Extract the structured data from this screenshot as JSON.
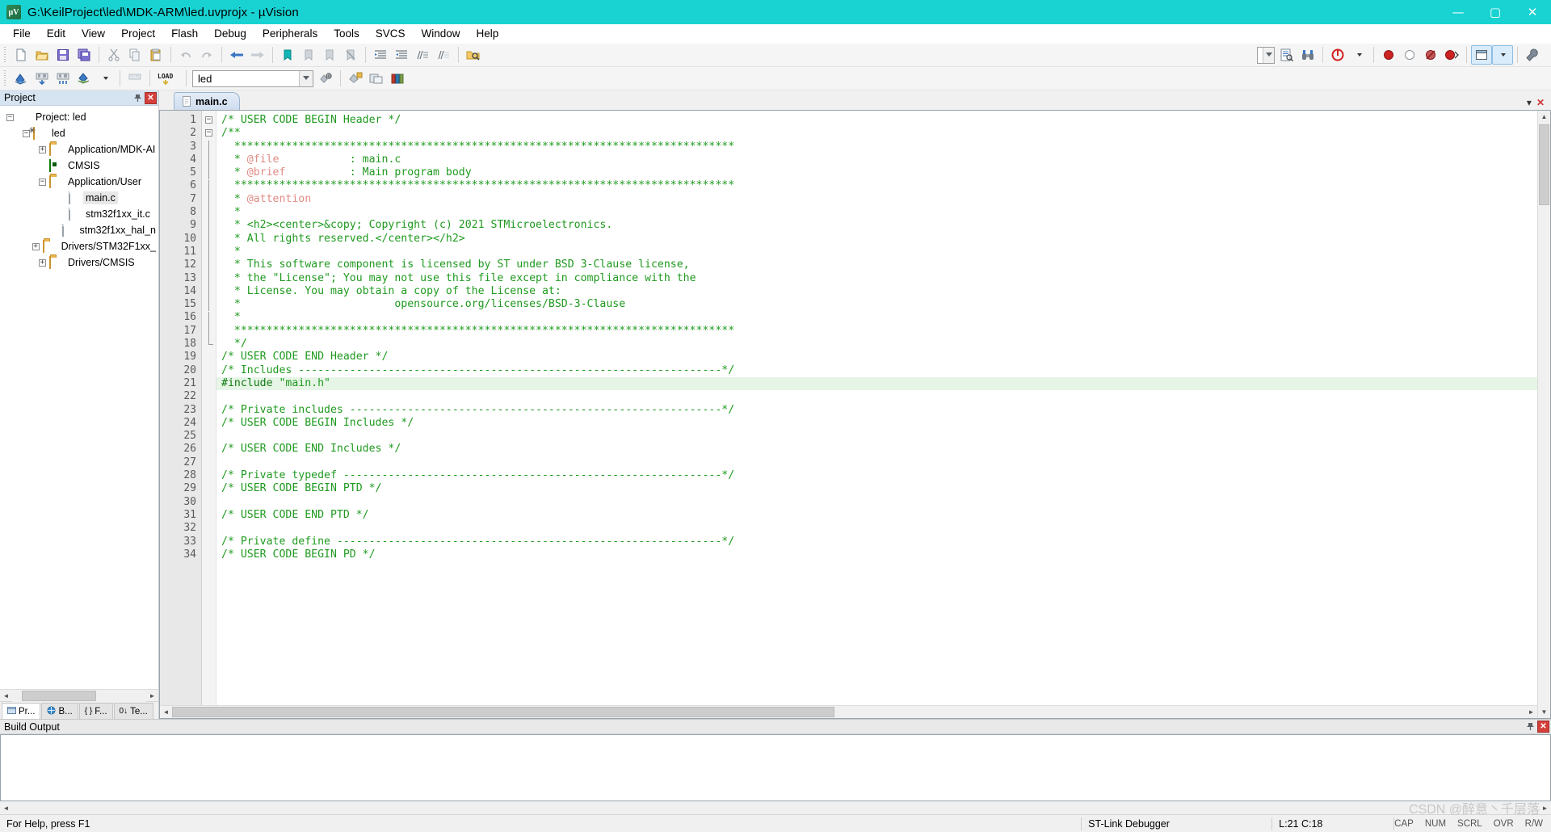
{
  "window": {
    "title": "G:\\KeilProject\\led\\MDK-ARM\\led.uvprojx - µVision",
    "app_icon": "uvision-icon",
    "minimize": "—",
    "maximize": "▢",
    "close": "✕"
  },
  "menu": {
    "items": [
      {
        "label": "File",
        "name": "menu-file"
      },
      {
        "label": "Edit",
        "name": "menu-edit"
      },
      {
        "label": "View",
        "name": "menu-view"
      },
      {
        "label": "Project",
        "name": "menu-project"
      },
      {
        "label": "Flash",
        "name": "menu-flash"
      },
      {
        "label": "Debug",
        "name": "menu-debug"
      },
      {
        "label": "Peripherals",
        "name": "menu-peripherals"
      },
      {
        "label": "Tools",
        "name": "menu-tools"
      },
      {
        "label": "SVCS",
        "name": "menu-svcs"
      },
      {
        "label": "Window",
        "name": "menu-window"
      },
      {
        "label": "Help",
        "name": "menu-help"
      }
    ]
  },
  "toolbar_main": {
    "buttons": [
      "new-file-icon",
      "open-file-icon",
      "save-icon",
      "save-all-icon",
      "cut-icon",
      "copy-icon",
      "paste-icon",
      "undo-icon",
      "redo-icon",
      "navigate-back-icon",
      "navigate-forward-icon",
      "bookmark-toggle-icon",
      "bookmark-prev-icon",
      "bookmark-next-icon",
      "bookmark-clear-icon",
      "indent-increase-icon",
      "indent-decrease-icon",
      "comment-lines-icon",
      "uncomment-lines-icon",
      "find-in-files-icon"
    ],
    "right_buttons": [
      "text-dropdown-icon",
      "find-replace-icon",
      "find-binoculars-icon",
      "debug-start-icon",
      "debug-dropdown-caret",
      "insert-breakpoint-icon",
      "kill-breakpoint-icon",
      "disable-breakpoint-icon",
      "kill-all-breakpoints-icon",
      "window-layout-icon",
      "layout-caret",
      "configure-wizard-icon"
    ]
  },
  "toolbar_build": {
    "buttons": [
      "translate-icon",
      "build-icon",
      "rebuild-icon",
      "batch-build-icon",
      "batch-build-caret",
      "stop-build-icon",
      "download-load-icon"
    ],
    "target_combo": {
      "name": "select-target-combo",
      "value": "led",
      "caret": "▾"
    },
    "right_buttons": [
      "target-options-icon",
      "manage-runtime-icon",
      "manage-project-items-icon",
      "multi-project-icon",
      "books-icon"
    ]
  },
  "project_panel": {
    "caption": "Project",
    "pin_icon": "pin-icon",
    "close_icon": "close-icon",
    "tree": [
      {
        "label": "Project: led",
        "indent": 0,
        "expander": "−",
        "icon": "project-icon",
        "selected": false
      },
      {
        "label": "led",
        "indent": 1,
        "expander": "−",
        "icon": "target-icon",
        "selected": false
      },
      {
        "label": "Application/MDK-AI",
        "indent": 2,
        "expander": "+",
        "icon": "folder-icon",
        "selected": false
      },
      {
        "label": "CMSIS",
        "indent": 2,
        "expander": "",
        "icon": "cmsis-icon",
        "selected": false
      },
      {
        "label": "Application/User",
        "indent": 2,
        "expander": "−",
        "icon": "folder-open-icon",
        "selected": false
      },
      {
        "label": "main.c",
        "indent": 3,
        "expander": "",
        "icon": "c-file-icon",
        "selected": true
      },
      {
        "label": "stm32f1xx_it.c",
        "indent": 3,
        "expander": "",
        "icon": "c-file-icon",
        "selected": false
      },
      {
        "label": "stm32f1xx_hal_n",
        "indent": 3,
        "expander": "",
        "icon": "c-file-icon",
        "selected": false
      },
      {
        "label": "Drivers/STM32F1xx_",
        "indent": 2,
        "expander": "+",
        "icon": "folder-icon",
        "selected": false
      },
      {
        "label": "Drivers/CMSIS",
        "indent": 2,
        "expander": "+",
        "icon": "folder-icon",
        "selected": false
      }
    ],
    "tabs": [
      {
        "label": "Pr...",
        "icon": "project-tab-icon",
        "active": true
      },
      {
        "label": "B...",
        "icon": "books-tab-icon",
        "active": false
      },
      {
        "label": "F...",
        "icon": "functions-tab-icon",
        "active": false
      },
      {
        "label": "Te...",
        "icon": "templates-tab-icon",
        "active": false
      }
    ]
  },
  "editor": {
    "tabs": [
      {
        "label": "main.c",
        "icon": "c-file-icon",
        "active": true
      }
    ],
    "tab_controls": {
      "minimize": "▾",
      "close": "✕"
    },
    "first_line": 1,
    "lines": [
      {
        "n": 1,
        "fold": "minus",
        "segments": [
          {
            "t": "/* USER CODE BEGIN Header */",
            "c": "cm"
          }
        ]
      },
      {
        "n": 2,
        "fold": "minus",
        "segments": [
          {
            "t": "/**",
            "c": "cm"
          }
        ]
      },
      {
        "n": 3,
        "fold": "bar",
        "segments": [
          {
            "t": "  ******************************************************************************",
            "c": "cm"
          }
        ]
      },
      {
        "n": 4,
        "fold": "bar",
        "segments": [
          {
            "t": "  * ",
            "c": "cm"
          },
          {
            "t": "@file",
            "c": "tag"
          },
          {
            "t": "           : main.c",
            "c": "cm"
          }
        ]
      },
      {
        "n": 5,
        "fold": "bar",
        "segments": [
          {
            "t": "  * ",
            "c": "cm"
          },
          {
            "t": "@brief",
            "c": "tag"
          },
          {
            "t": "          : Main program body",
            "c": "cm"
          }
        ]
      },
      {
        "n": 6,
        "fold": "bar",
        "segments": [
          {
            "t": "  ******************************************************************************",
            "c": "cm"
          }
        ]
      },
      {
        "n": 7,
        "fold": "bar",
        "segments": [
          {
            "t": "  * ",
            "c": "cm"
          },
          {
            "t": "@attention",
            "c": "tag"
          }
        ]
      },
      {
        "n": 8,
        "fold": "bar",
        "segments": [
          {
            "t": "  *",
            "c": "cm"
          }
        ]
      },
      {
        "n": 9,
        "fold": "bar",
        "segments": [
          {
            "t": "  * <h2><center>&copy; Copyright (c) 2021 STMicroelectronics.",
            "c": "cm"
          }
        ]
      },
      {
        "n": 10,
        "fold": "bar",
        "segments": [
          {
            "t": "  * All rights reserved.</center></h2>",
            "c": "cm"
          }
        ]
      },
      {
        "n": 11,
        "fold": "bar",
        "segments": [
          {
            "t": "  *",
            "c": "cm"
          }
        ]
      },
      {
        "n": 12,
        "fold": "bar",
        "segments": [
          {
            "t": "  * This software component is licensed by ST under BSD 3-Clause license,",
            "c": "cm"
          }
        ]
      },
      {
        "n": 13,
        "fold": "bar",
        "segments": [
          {
            "t": "  * the \"License\"; You may not use this file except in compliance with the",
            "c": "cm"
          }
        ]
      },
      {
        "n": 14,
        "fold": "bar",
        "segments": [
          {
            "t": "  * License. You may obtain a copy of the License at:",
            "c": "cm"
          }
        ]
      },
      {
        "n": 15,
        "fold": "bar",
        "segments": [
          {
            "t": "  *                        opensource.org/licenses/BSD-3-Clause",
            "c": "cm"
          }
        ]
      },
      {
        "n": 16,
        "fold": "bar",
        "segments": [
          {
            "t": "  *",
            "c": "cm"
          }
        ]
      },
      {
        "n": 17,
        "fold": "bar",
        "segments": [
          {
            "t": "  ******************************************************************************",
            "c": "cm"
          }
        ]
      },
      {
        "n": 18,
        "fold": "end",
        "segments": [
          {
            "t": "  */",
            "c": "cm"
          }
        ]
      },
      {
        "n": 19,
        "fold": "",
        "segments": [
          {
            "t": "/* USER CODE END Header */",
            "c": "cm"
          }
        ]
      },
      {
        "n": 20,
        "fold": "",
        "segments": [
          {
            "t": "/* Includes ------------------------------------------------------------------*/",
            "c": "cm"
          }
        ]
      },
      {
        "n": 21,
        "fold": "",
        "hl": true,
        "segments": [
          {
            "t": "#include",
            "c": "pp"
          },
          {
            "t": " ",
            "c": ""
          },
          {
            "t": "\"main.h\"",
            "c": "str"
          }
        ]
      },
      {
        "n": 22,
        "fold": "",
        "segments": [
          {
            "t": "",
            "c": ""
          }
        ]
      },
      {
        "n": 23,
        "fold": "",
        "segments": [
          {
            "t": "/* Private includes ----------------------------------------------------------*/",
            "c": "cm"
          }
        ]
      },
      {
        "n": 24,
        "fold": "",
        "segments": [
          {
            "t": "/* USER CODE BEGIN Includes */",
            "c": "cm"
          }
        ]
      },
      {
        "n": 25,
        "fold": "",
        "segments": [
          {
            "t": "",
            "c": ""
          }
        ]
      },
      {
        "n": 26,
        "fold": "",
        "segments": [
          {
            "t": "/* USER CODE END Includes */",
            "c": "cm"
          }
        ]
      },
      {
        "n": 27,
        "fold": "",
        "segments": [
          {
            "t": "",
            "c": ""
          }
        ]
      },
      {
        "n": 28,
        "fold": "",
        "segments": [
          {
            "t": "/* Private typedef -----------------------------------------------------------*/",
            "c": "cm"
          }
        ]
      },
      {
        "n": 29,
        "fold": "",
        "segments": [
          {
            "t": "/* USER CODE BEGIN PTD */",
            "c": "cm"
          }
        ]
      },
      {
        "n": 30,
        "fold": "",
        "segments": [
          {
            "t": "",
            "c": ""
          }
        ]
      },
      {
        "n": 31,
        "fold": "",
        "segments": [
          {
            "t": "/* USER CODE END PTD */",
            "c": "cm"
          }
        ]
      },
      {
        "n": 32,
        "fold": "",
        "segments": [
          {
            "t": "",
            "c": ""
          }
        ]
      },
      {
        "n": 33,
        "fold": "",
        "segments": [
          {
            "t": "/* Private define ------------------------------------------------------------*/",
            "c": "cm"
          }
        ]
      },
      {
        "n": 34,
        "fold": "",
        "segments": [
          {
            "t": "/* USER CODE BEGIN PD */",
            "c": "cm"
          }
        ]
      }
    ]
  },
  "build_output": {
    "caption": "Build Output",
    "pin_icon": "pin-icon",
    "close_icon": "close-icon",
    "content": ""
  },
  "status_bar": {
    "help_text": "For Help, press F1",
    "debugger": "ST-Link Debugger",
    "cursor": "L:21 C:18",
    "indicators": [
      "CAP",
      "NUM",
      "SCRL",
      "OVR",
      "R/W"
    ]
  },
  "watermark": "CSDN @醉意丶千层落",
  "colors": {
    "title_bar": "#19d3d3",
    "comment_green": "#1f9a1f",
    "doc_tag_salmon": "#e08b84",
    "preproc_green": "#0f7a0f",
    "highlight_line": "#e6f5e6",
    "panel_caption": "#d6e3f0",
    "tab_active": "#cfddf0"
  }
}
